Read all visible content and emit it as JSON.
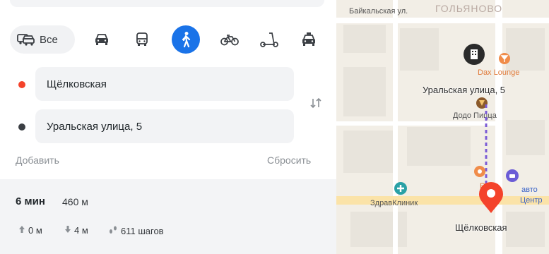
{
  "modes": {
    "all_label": "Все",
    "items": [
      {
        "name": "all",
        "icon": "car-bus-icon"
      },
      {
        "name": "car",
        "icon": "car-icon"
      },
      {
        "name": "transit",
        "icon": "bus-icon"
      },
      {
        "name": "walk",
        "icon": "pedestrian-icon",
        "active": true
      },
      {
        "name": "bike",
        "icon": "bicycle-icon"
      },
      {
        "name": "scooter",
        "icon": "scooter-icon"
      },
      {
        "name": "taxi",
        "icon": "taxi-icon"
      }
    ]
  },
  "route_form": {
    "from_value": "Щёлковская",
    "to_value": "Уральская улица, 5",
    "add_label": "Добавить",
    "reset_label": "Сбросить"
  },
  "route": {
    "time": "6 мин",
    "distance": "460 м",
    "ascent": "0 м",
    "descent": "4 м",
    "steps": "611 шагов"
  },
  "map": {
    "street_top": "Байкальская ул.",
    "district_top": "ГОЛЬЯНОВО",
    "poi_lounge": "Dax Lounge",
    "poi_pizza": "Додо Пицца",
    "poi_clinic": "ЗдравКлиник",
    "poi_ro": "Ro",
    "poi_avto": "авто",
    "poi_centr": "Центр",
    "destination_label": "Уральская улица, 5",
    "origin_label": "Щёлковская"
  },
  "colors": {
    "accent": "#1a73e8",
    "origin_dot": "#f4432b",
    "destination_dot": "#3b3f44",
    "route_line": "#7b5cd6"
  }
}
